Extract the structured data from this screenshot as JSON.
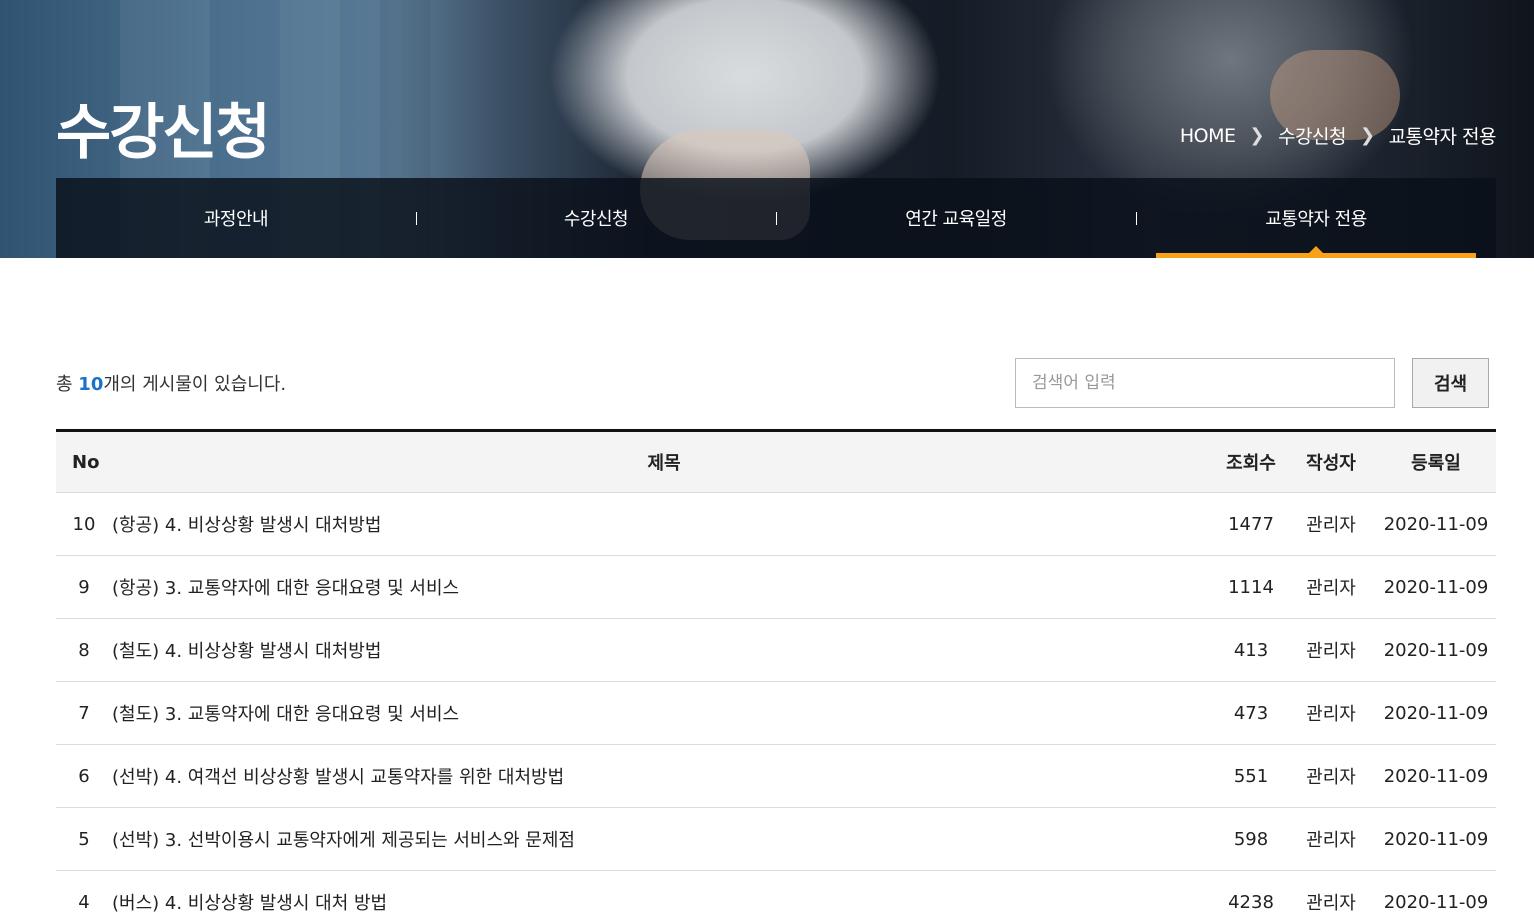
{
  "hero": {
    "title": "수강신청",
    "breadcrumb": [
      "HOME",
      "수강신청",
      "교통약자 전용"
    ]
  },
  "subnav": {
    "tabs": [
      {
        "label": "과정안내",
        "active": false
      },
      {
        "label": "수강신청",
        "active": false
      },
      {
        "label": "연간 교육일정",
        "active": false
      },
      {
        "label": "교통약자 전용",
        "active": true
      }
    ],
    "accent_color": "#f9a11b"
  },
  "board": {
    "count_prefix": "총 ",
    "count": "10",
    "count_suffix": "개의 게시물이 있습니다.",
    "search": {
      "placeholder": "검색어 입력",
      "value": "",
      "button_label": "검색"
    },
    "columns": {
      "no": "No",
      "title": "제목",
      "views": "조회수",
      "author": "작성자",
      "date": "등록일"
    },
    "rows": [
      {
        "no": "10",
        "title": "(항공) 4. 비상상황 발생시 대처방법",
        "views": "1477",
        "author": "관리자",
        "date": "2020-11-09"
      },
      {
        "no": "9",
        "title": "(항공) 3. 교통약자에 대한 응대요령 및 서비스",
        "views": "1114",
        "author": "관리자",
        "date": "2020-11-09"
      },
      {
        "no": "8",
        "title": "(철도) 4. 비상상황 발생시 대처방법",
        "views": "413",
        "author": "관리자",
        "date": "2020-11-09"
      },
      {
        "no": "7",
        "title": "(철도) 3. 교통약자에 대한 응대요령 및 서비스",
        "views": "473",
        "author": "관리자",
        "date": "2020-11-09"
      },
      {
        "no": "6",
        "title": "(선박) 4. 여객선 비상상황 발생시 교통약자를 위한 대처방법",
        "views": "551",
        "author": "관리자",
        "date": "2020-11-09"
      },
      {
        "no": "5",
        "title": "(선박) 3. 선박이용시 교통약자에게 제공되는 서비스와 문제점",
        "views": "598",
        "author": "관리자",
        "date": "2020-11-09"
      },
      {
        "no": "4",
        "title": "(버스) 4. 비상상황 발생시 대처 방법",
        "views": "4238",
        "author": "관리자",
        "date": "2020-11-09"
      }
    ],
    "count_color": "#1a73c8"
  }
}
